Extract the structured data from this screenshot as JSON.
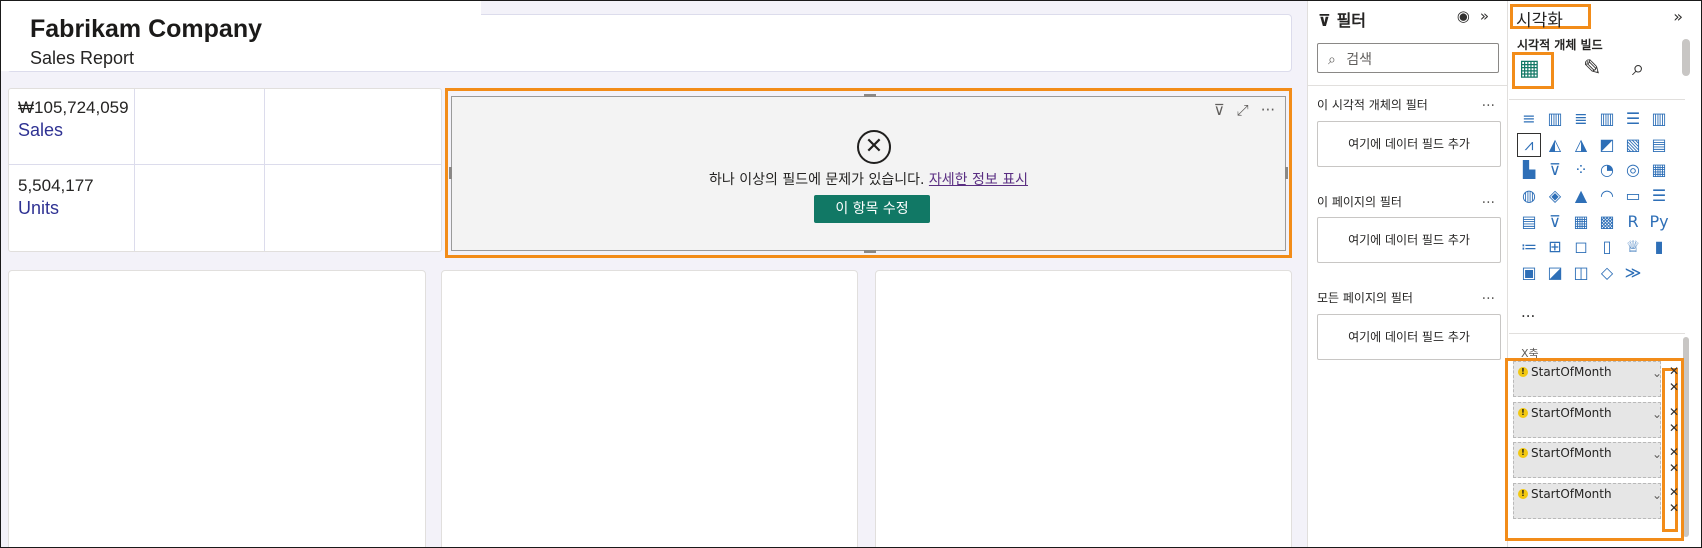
{
  "report": {
    "company": "Fabrikam Company",
    "subtitle": "Sales Report"
  },
  "kpis": [
    {
      "value": "₩105,724,059",
      "label": "Sales"
    },
    {
      "value": "5,504,177",
      "label": "Units"
    }
  ],
  "error_visual": {
    "message": "하나 이상의 필드에 문제가 있습니다.",
    "details_link": "자세한 정보 표시",
    "fix_button": "이 항목 수정",
    "toolbar_icons": [
      "filter-icon",
      "focus-mode-icon",
      "more-options-icon"
    ]
  },
  "filters_pane": {
    "title": "필터",
    "search_placeholder": "검색",
    "sections": [
      {
        "title": "이 시각적 개체의 필터",
        "well": "여기에 데이터 필드 추가"
      },
      {
        "title": "이 페이지의 필터",
        "well": "여기에 데이터 필드 추가"
      },
      {
        "title": "모든 페이지의 필터",
        "well": "여기에 데이터 필드 추가"
      }
    ],
    "more": "..."
  },
  "viz_pane": {
    "title": "시각화",
    "subtitle": "시각적 개체 빌드",
    "more": "...",
    "axis_label": "X축",
    "fields": [
      {
        "name": "StartOfMonth"
      },
      {
        "name": "StartOfMonth"
      },
      {
        "name": "StartOfMonth"
      },
      {
        "name": "StartOfMonth"
      }
    ],
    "colors": {
      "highlight": "#f28c19",
      "button": "#117865",
      "kpi_label": "#2f3293"
    }
  }
}
